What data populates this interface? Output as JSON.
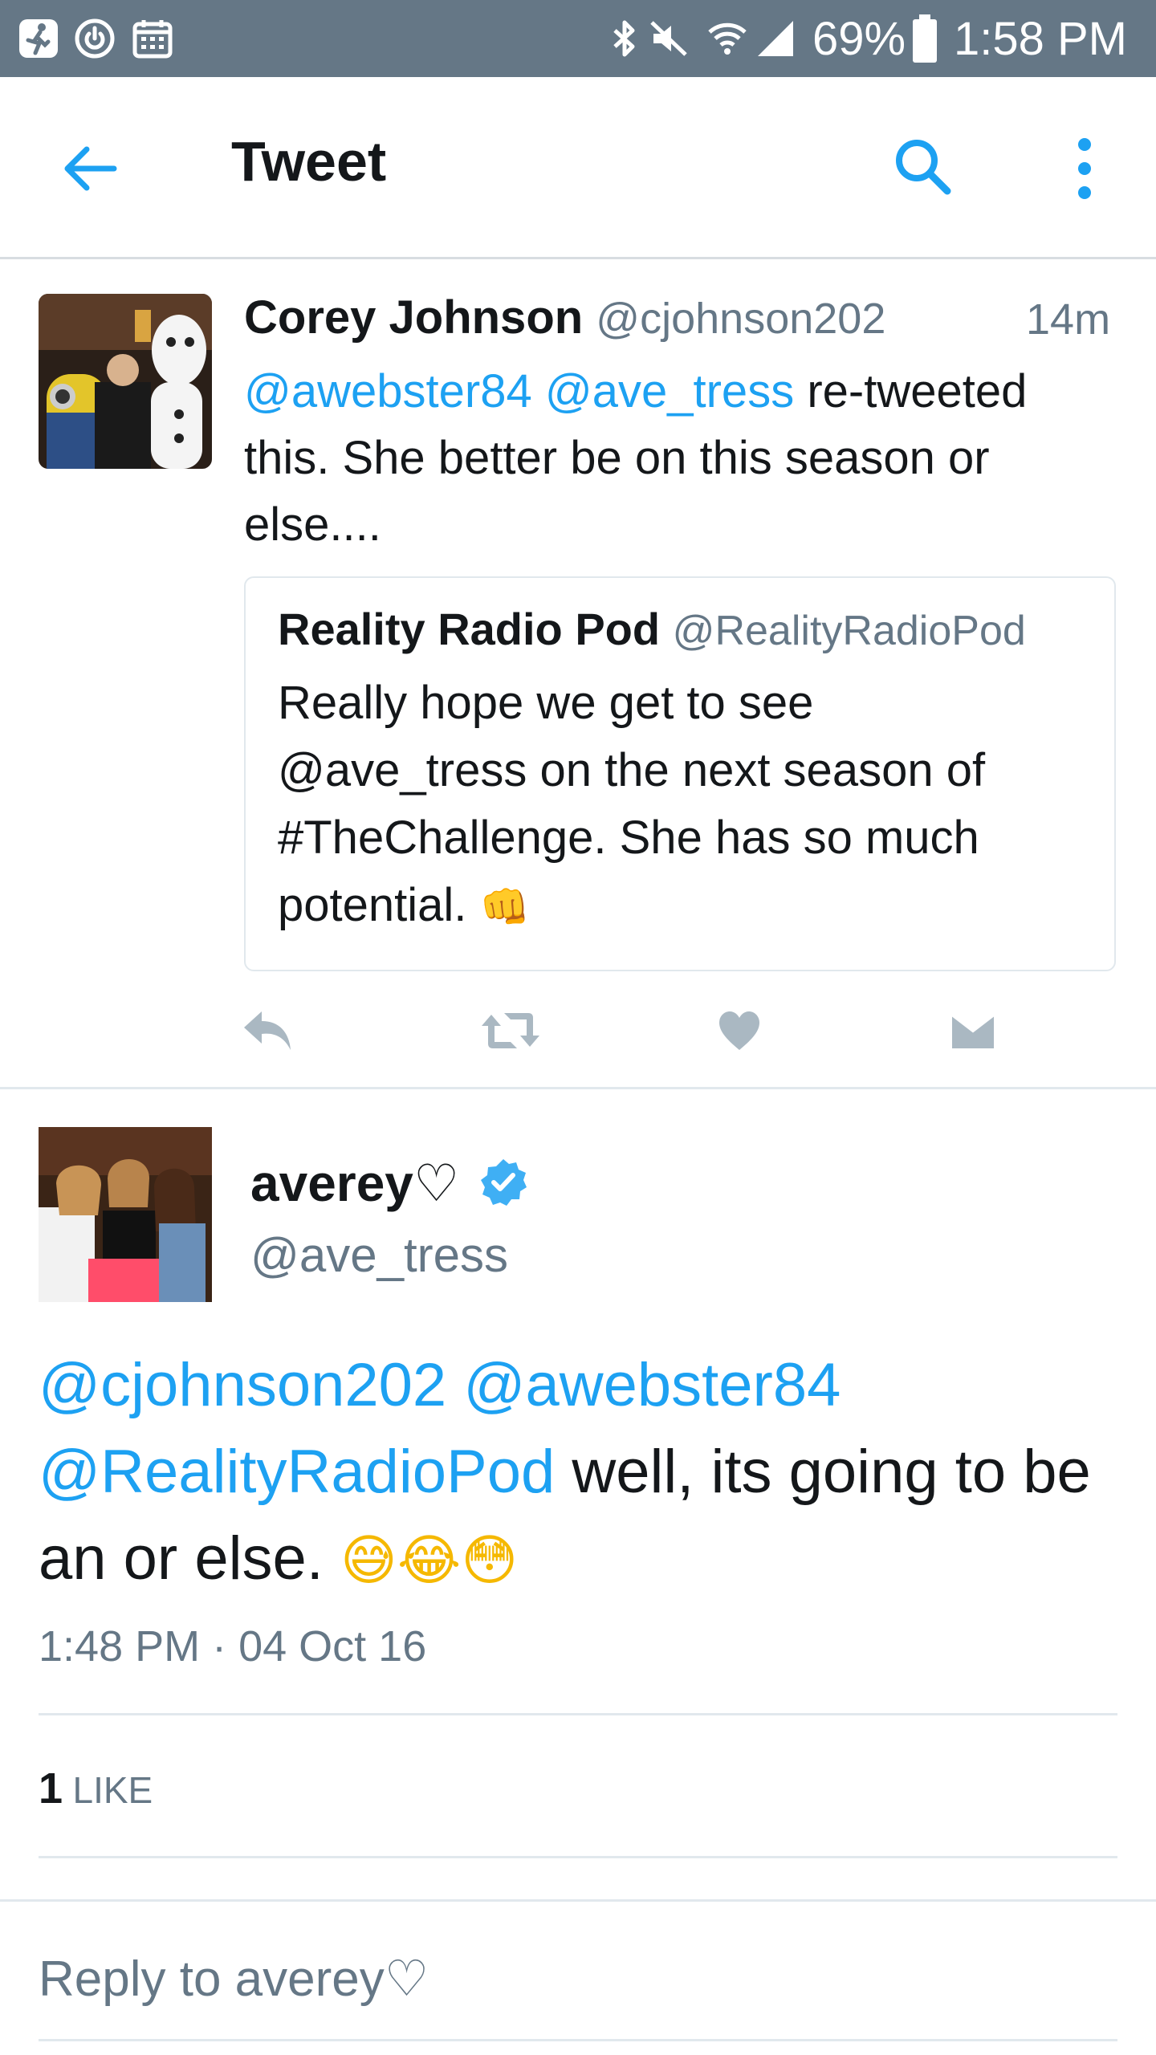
{
  "status_bar": {
    "battery": "69%",
    "time": "1:58 PM",
    "icons": [
      "running-icon",
      "power-icon",
      "calendar-icon",
      "bluetooth-icon",
      "mute-icon",
      "wifi-icon",
      "signal-icon",
      "battery-icon"
    ]
  },
  "header": {
    "title": "Tweet",
    "back_icon": "arrow-left-icon",
    "search_icon": "search-icon",
    "menu_icon": "more-vertical-icon"
  },
  "reply_tweet": {
    "name": "Corey Johnson",
    "handle": "@cjohnson202",
    "time": "14m",
    "mention_1": "@awebster84",
    "mention_2": "@ave_tress",
    "text_line_1": " re-tweeted",
    "text_line_2": "this.  She better be on this season or",
    "text_line_3": "else....",
    "quote": {
      "name": "Reality Radio Pod",
      "handle": "@RealityRadioPod",
      "line_1": "Really hope we get to see",
      "line_2": "@ave_tress on the next season of",
      "line_3": "#TheChallenge. She has so much",
      "line_4": "potential.",
      "emoji": "👊"
    },
    "actions": [
      "reply-icon",
      "retweet-icon",
      "like-icon",
      "direct-message-icon"
    ]
  },
  "main_tweet": {
    "name": "averey♡",
    "handle": "@ave_tress",
    "verified_icon": "verified-badge-icon",
    "mention_1": "@cjohnson202",
    "mention_2": "@awebster84",
    "mention_3": "@RealityRadioPod",
    "text_1": " well, its going to be",
    "text_2": "an or else.",
    "emojis": [
      "😅",
      "😂",
      "😳"
    ],
    "timestamp": "1:48 PM · 04 Oct 16",
    "likes_count": "1",
    "likes_label": "LIKE"
  },
  "reply_box": {
    "placeholder": "Reply to averey♡"
  },
  "colors": {
    "status_bar": "#657786",
    "link": "#1da1f2",
    "muted": "#657786",
    "action_icon": "#aab8c2",
    "text": "#14171a"
  }
}
